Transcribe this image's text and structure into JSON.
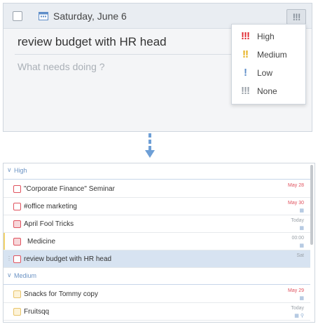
{
  "editor": {
    "date_day": "Saturday",
    "date_sep": ",",
    "date_rest": "June 6",
    "priority_button": "!!!",
    "title": "review budget with HR head",
    "placeholder": "What needs doing ?"
  },
  "priority_menu": {
    "items": [
      {
        "glyph": "!!!",
        "label": "High",
        "color": "#e02b33"
      },
      {
        "glyph": "!!",
        "label": "Medium",
        "color": "#e6b01c"
      },
      {
        "glyph": "!",
        "label": "Low",
        "color": "#5f8ec9"
      },
      {
        "glyph": "!!!",
        "label": "None",
        "color": "#9aa1a8"
      }
    ]
  },
  "list": {
    "groups": [
      {
        "name": "High",
        "tasks": [
          {
            "title": "\"Corporate Finance\" Seminar",
            "date": "May 28",
            "date_red": true,
            "icons": ""
          },
          {
            "title": "#office marketing",
            "date": "May 30",
            "date_red": true,
            "icons": "calendar-icon"
          },
          {
            "title": "April Fool Tricks",
            "date": "Today",
            "date_red": false,
            "icons": "calendar-icon"
          },
          {
            "title": "Medicine",
            "date": "00:00",
            "date_red": false,
            "icons": "calendar-icon"
          },
          {
            "title": "review budget with HR head",
            "date": "Sat",
            "date_red": false,
            "icons": "",
            "selected": true
          }
        ]
      },
      {
        "name": "Medium",
        "tasks": [
          {
            "title": "Snacks for Tommy copy",
            "date": "May 29",
            "date_red": true,
            "icons": "calendar-icon"
          },
          {
            "title": "Fruitsqq",
            "date": "Today",
            "date_red": false,
            "icons": "calendar-icon location-icon"
          }
        ]
      }
    ]
  },
  "colors": {
    "accent_blue": "#5f8ec9",
    "priority_high": "#e02b33",
    "priority_medium": "#e6b01c",
    "selection": "#d7e3f1"
  }
}
